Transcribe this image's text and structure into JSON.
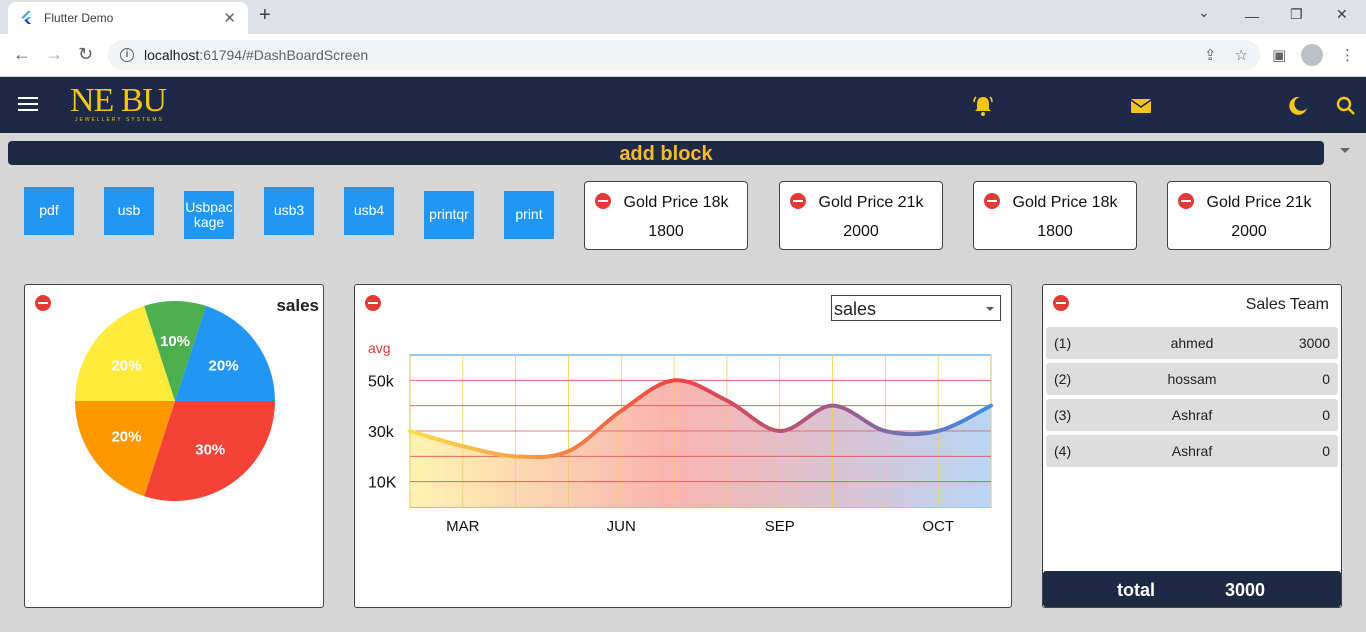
{
  "browser": {
    "tab_title": "Flutter Demo",
    "url_host": "localhost",
    "url_path": ":61794/#DashBoardScreen"
  },
  "add_block": {
    "label": "add block"
  },
  "buttons": [
    {
      "label": "pdf"
    },
    {
      "label": "usb"
    },
    {
      "label": "Usbpackage"
    },
    {
      "label": "usb3"
    },
    {
      "label": "usb4"
    },
    {
      "label": "printqr"
    },
    {
      "label": "print"
    }
  ],
  "price_cards": [
    {
      "title": "Gold Price 18k",
      "value": "1800"
    },
    {
      "title": "Gold Price 21k",
      "value": "2000"
    },
    {
      "title": "Gold Price 18k",
      "value": "1800"
    },
    {
      "title": "Gold Price 21k",
      "value": "2000"
    }
  ],
  "pie_panel": {
    "title": "sales"
  },
  "line_panel": {
    "dropdown_value": "sales"
  },
  "team_panel": {
    "title": "Sales Team",
    "rows": [
      {
        "index": "(1)",
        "name": "ahmed",
        "amount": "3000"
      },
      {
        "index": "(2)",
        "name": "hossam",
        "amount": "0"
      },
      {
        "index": "(3)",
        "name": "Ashraf",
        "amount": "0"
      },
      {
        "index": "(4)",
        "name": "Ashraf",
        "amount": "0"
      }
    ],
    "total_label": "total",
    "total_value": "3000"
  },
  "colors": {
    "navy": "#1e2a45",
    "accent_yellow": "#f5c518",
    "button_blue": "#2196f3",
    "remove_red": "#e53935"
  },
  "chart_data": [
    {
      "type": "pie",
      "title": "sales",
      "slices": [
        {
          "label": "20%",
          "value": 20,
          "color": "#2196f3"
        },
        {
          "label": "30%",
          "value": 30,
          "color": "#f44336"
        },
        {
          "label": "20%",
          "value": 20,
          "color": "#ff9800"
        },
        {
          "label": "20%",
          "value": 20,
          "color": "#ffeb3b"
        },
        {
          "label": "10%",
          "value": 10,
          "color": "#4caf50"
        }
      ]
    },
    {
      "type": "line",
      "ylabel": "avg",
      "x": [
        0,
        1,
        2,
        3,
        4,
        5,
        6,
        7,
        8,
        9,
        10,
        11
      ],
      "x_ticks": [
        {
          "x": 1,
          "label": "MAR"
        },
        {
          "x": 4,
          "label": "JUN"
        },
        {
          "x": 7,
          "label": "SEP"
        },
        {
          "x": 10,
          "label": "OCT"
        }
      ],
      "y_ticks": [
        {
          "y": 1,
          "label": "10K"
        },
        {
          "y": 3,
          "label": "30k"
        },
        {
          "y": 5,
          "label": "50k"
        }
      ],
      "ylim": [
        0,
        6
      ],
      "series": [
        {
          "values": [
            3,
            2.4,
            2,
            2.2,
            3.8,
            5,
            4.2,
            3,
            4,
            3,
            3,
            4
          ]
        }
      ],
      "grid": true
    }
  ]
}
